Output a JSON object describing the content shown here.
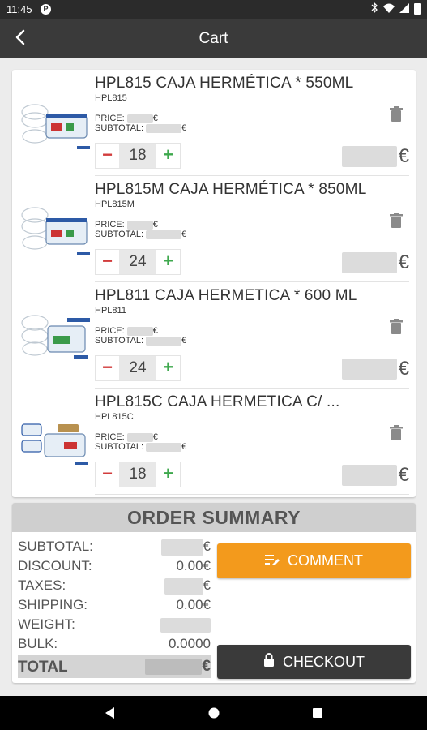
{
  "status_bar": {
    "time": "11:45",
    "notification_icon": "P"
  },
  "app_bar": {
    "title": "Cart"
  },
  "cart": {
    "items": [
      {
        "title": "HPL815 CAJA HERMÉTICA * 550ML",
        "sku": "HPL815",
        "price_label": "PRICE:",
        "subtotal_label": "SUBTOTAL:",
        "currency": "€",
        "quantity": "18",
        "total_currency": "€",
        "minus": "−",
        "plus": "+"
      },
      {
        "title": "HPL815M CAJA HERMÉTICA * 850ML",
        "sku": "HPL815M",
        "price_label": "PRICE:",
        "subtotal_label": "SUBTOTAL:",
        "currency": "€",
        "quantity": "24",
        "total_currency": "€",
        "minus": "−",
        "plus": "+"
      },
      {
        "title": "HPL811 CAJA HERMETICA * 600 ML",
        "sku": "HPL811",
        "price_label": "PRICE:",
        "subtotal_label": "SUBTOTAL:",
        "currency": "€",
        "quantity": "24",
        "total_currency": "€",
        "minus": "−",
        "plus": "+"
      },
      {
        "title": "HPL815C CAJA HERMETICA C/ ...",
        "sku": "HPL815C",
        "price_label": "PRICE:",
        "subtotal_label": "SUBTOTAL:",
        "currency": "€",
        "quantity": "18",
        "total_currency": "€",
        "minus": "−",
        "plus": "+"
      }
    ]
  },
  "summary": {
    "heading": "ORDER SUMMARY",
    "rows": [
      {
        "label": "SUBTOTAL:",
        "value": "€"
      },
      {
        "label": "DISCOUNT:",
        "value": "0.00€"
      },
      {
        "label": "TAXES:",
        "value": "€"
      },
      {
        "label": "SHIPPING:",
        "value": "0.00€"
      },
      {
        "label": "WEIGHT:",
        "value": ""
      },
      {
        "label": "BULK:",
        "value": "0.0000"
      }
    ],
    "total_label": "TOTAL",
    "total_value": "€",
    "comment_label": "COMMENT",
    "checkout_label": "CHECKOUT"
  },
  "colors": {
    "accent": "#f39a1c",
    "dark": "#3a3a3a",
    "minus": "#d23c3c",
    "plus": "#3ea84d"
  },
  "icons": [
    "back-arrow-icon",
    "trash-icon",
    "comment-icon",
    "lock-icon",
    "nav-back-icon",
    "nav-home-icon",
    "nav-recents-icon"
  ]
}
